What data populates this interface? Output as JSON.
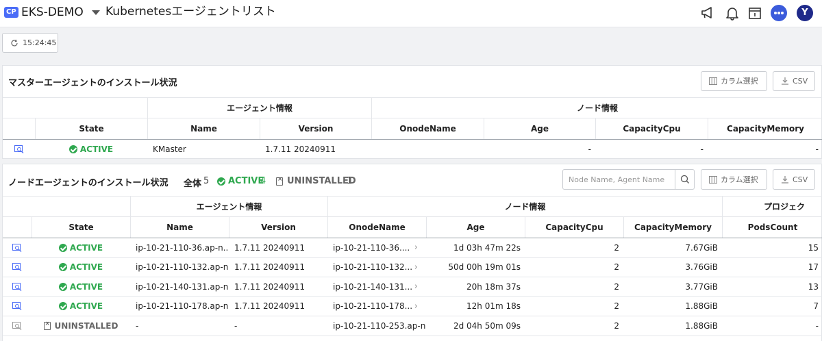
{
  "header": {
    "badge": "CP",
    "project": "EKS-DEMO",
    "title": "Kubernetesエージェントリスト",
    "avatar": "Y"
  },
  "toolbar": {
    "time": "15:24:45"
  },
  "master": {
    "title": "マスターエージェントのインストール状況",
    "column_select": "カラム選択",
    "csv": "CSV",
    "group_agent": "エージェント情報",
    "group_node": "ノード情報",
    "columns": [
      "State",
      "Name",
      "Version",
      "OnodeName",
      "Age",
      "CapacityCpu",
      "CapacityMemory"
    ],
    "rows": [
      {
        "state": "ACTIVE",
        "name": "KMaster",
        "version": "1.7.11 20240911",
        "onode": "",
        "age": "-",
        "cpu": "-",
        "mem": "-"
      }
    ]
  },
  "node": {
    "title": "ノードエージェントのインストール状況",
    "total_label": "全体",
    "total_count": "5",
    "active_label": "ACTIVE",
    "active_count": "4",
    "uninstalled_label": "UNINSTALLED",
    "uninstalled_count": "1",
    "search_placeholder": "Node Name, Agent Name",
    "column_select": "カラム選択",
    "csv": "CSV",
    "group_agent": "エージェント情報",
    "group_node": "ノード情報",
    "group_project": "プロジェク",
    "columns": [
      "State",
      "Name",
      "Version",
      "OnodeName",
      "Age",
      "CapacityCpu",
      "CapacityMemory",
      "PodsCount"
    ],
    "rows": [
      {
        "state": "ACTIVE",
        "name": "ip-10-21-110-36.ap-n...",
        "version": "1.7.11 20240911",
        "onode": "ip-10-21-110-36....",
        "age": "1d 03h 47m 22s",
        "cpu": "2",
        "mem": "7.67GiB",
        "pods": "15"
      },
      {
        "state": "ACTIVE",
        "name": "ip-10-21-110-132.ap-n...",
        "version": "1.7.11 20240911",
        "onode": "ip-10-21-110-132...",
        "age": "50d 00h 19m 01s",
        "cpu": "2",
        "mem": "3.76GiB",
        "pods": "17"
      },
      {
        "state": "ACTIVE",
        "name": "ip-10-21-140-131.ap-n...",
        "version": "1.7.11 20240911",
        "onode": "ip-10-21-140-131...",
        "age": "20h 18m 37s",
        "cpu": "2",
        "mem": "3.77GiB",
        "pods": "13"
      },
      {
        "state": "ACTIVE",
        "name": "ip-10-21-110-178.ap-n...",
        "version": "1.7.11 20240911",
        "onode": "ip-10-21-110-178...",
        "age": "12h 01m 18s",
        "cpu": "2",
        "mem": "1.88GiB",
        "pods": "7"
      },
      {
        "state": "UNINSTALLED",
        "name": "-",
        "version": "-",
        "onode": "ip-10-21-110-253.ap-n...",
        "age": "2d 04h 50m 09s",
        "cpu": "2",
        "mem": "1.88GiB",
        "pods": "-"
      }
    ]
  },
  "colors": {
    "accent": "#4a6cf7",
    "active": "#2fa84f",
    "avatar": "#1f2a8a"
  }
}
